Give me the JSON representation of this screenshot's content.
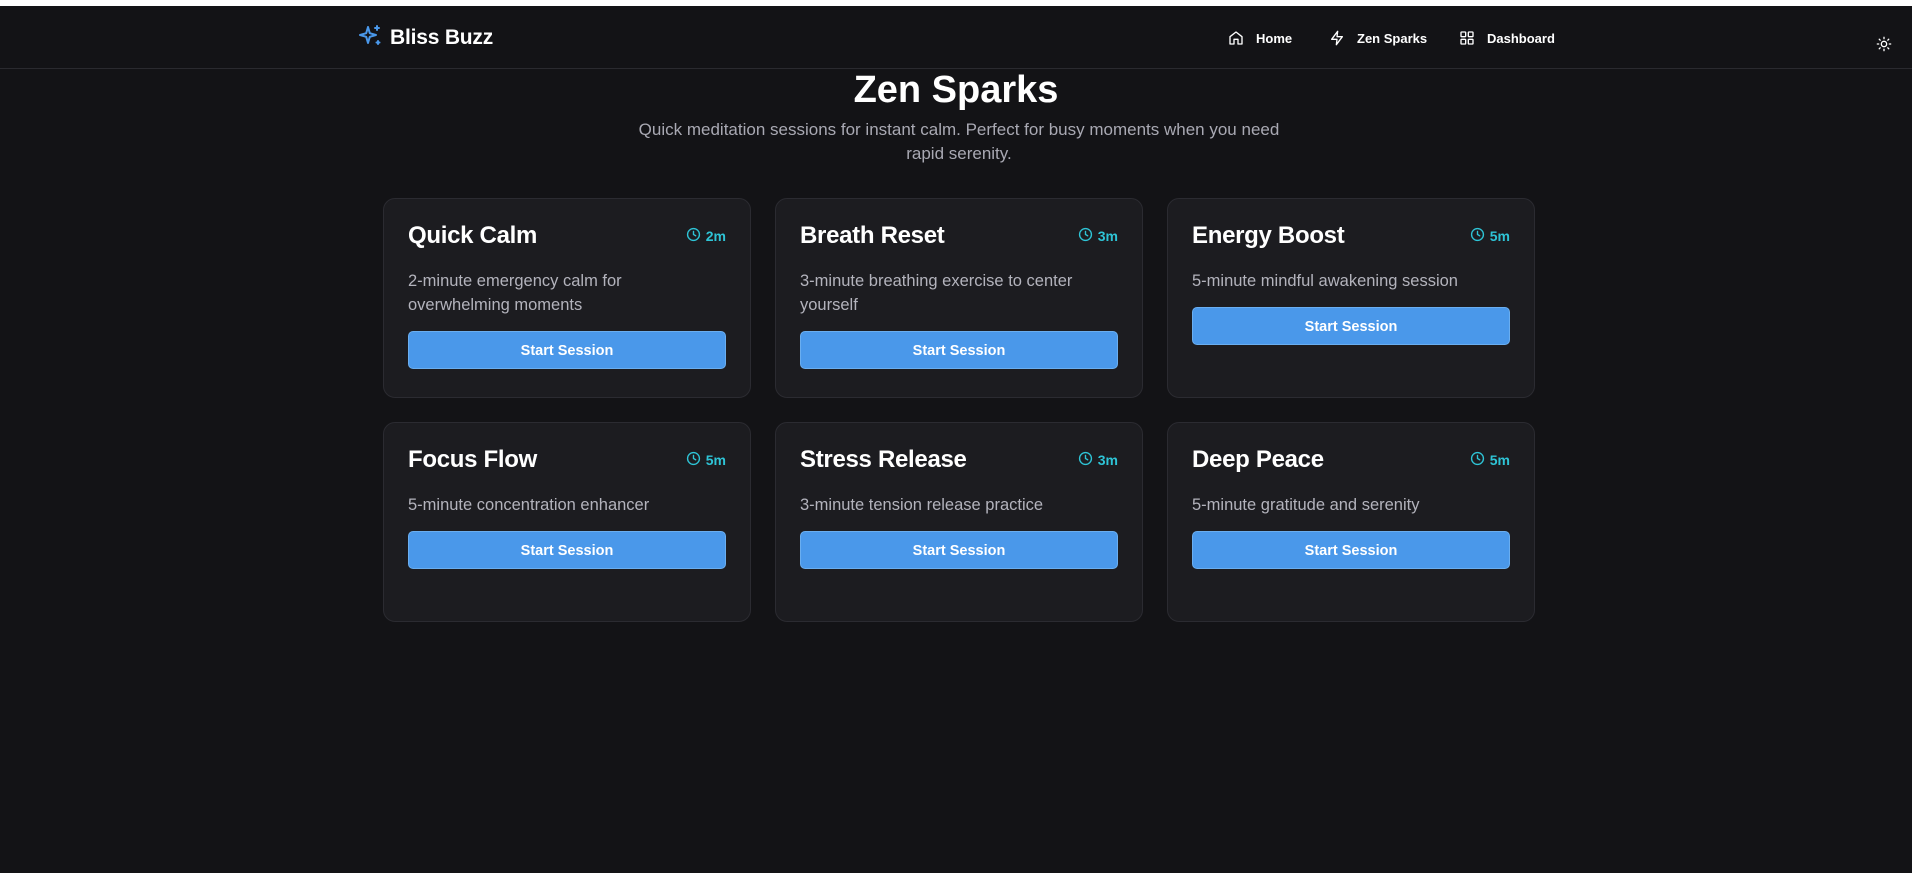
{
  "brand": {
    "name": "Bliss Buzz",
    "icon": "sparkles-icon",
    "accent": "#4a98ea"
  },
  "nav": {
    "items": [
      {
        "label": "Home",
        "icon": "home-icon"
      },
      {
        "label": "Zen Sparks",
        "icon": "zap-icon"
      },
      {
        "label": "Dashboard",
        "icon": "grid-icon"
      }
    ],
    "theme_toggle_icon": "sun-icon"
  },
  "page": {
    "title": "Zen Sparks",
    "subtitle": "Quick meditation sessions for instant calm. Perfect for busy moments when you need rapid serenity."
  },
  "sessions": [
    {
      "title": "Quick Calm",
      "duration": "2m",
      "description": "2-minute emergency calm for overwhelming moments",
      "button": "Start Session"
    },
    {
      "title": "Breath Reset",
      "duration": "3m",
      "description": "3-minute breathing exercise to center yourself",
      "button": "Start Session"
    },
    {
      "title": "Energy Boost",
      "duration": "5m",
      "description": "5-minute mindful awakening session",
      "button": "Start Session"
    },
    {
      "title": "Focus Flow",
      "duration": "5m",
      "description": "5-minute concentration enhancer",
      "button": "Start Session"
    },
    {
      "title": "Stress Release",
      "duration": "3m",
      "description": "3-minute tension release practice",
      "button": "Start Session"
    },
    {
      "title": "Deep Peace",
      "duration": "5m",
      "description": "5-minute gratitude and serenity",
      "button": "Start Session"
    }
  ],
  "colors": {
    "background": "#131316",
    "card": "#1c1c20",
    "button": "#4a98ea",
    "duration": "#2ec4d6"
  }
}
